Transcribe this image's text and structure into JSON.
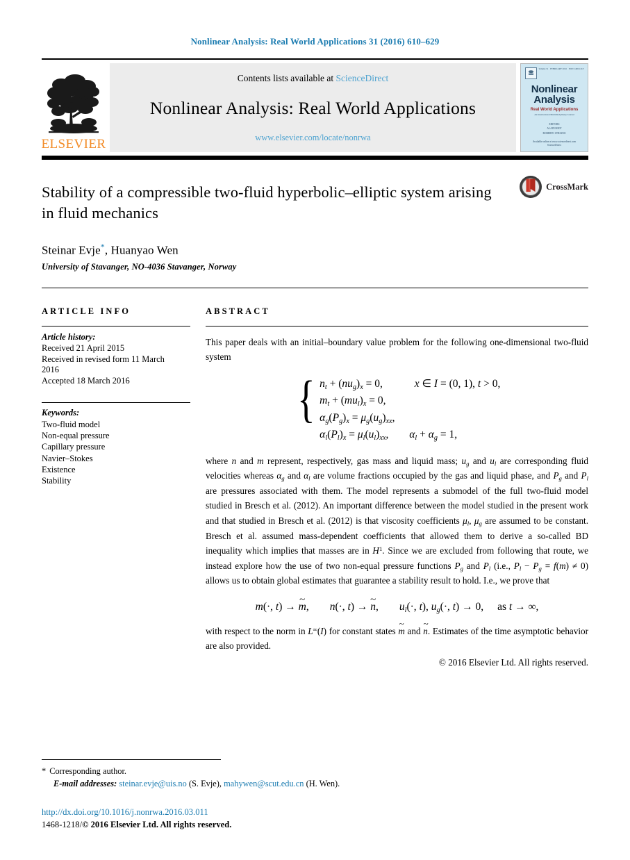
{
  "running_head": "Nonlinear Analysis: Real World Applications 31 (2016) 610–629",
  "masthead": {
    "contents_prefix": "Contents lists available at ",
    "sciencedirect": "ScienceDirect",
    "journal_title": "Nonlinear Analysis: Real World Applications",
    "journal_url": "www.elsevier.com/locate/nonrwa",
    "publisher": "ELSEVIER",
    "cover": {
      "title_line1": "Nonlinear",
      "title_line2": "Analysis",
      "subtitle": "Real World Applications",
      "subtitle2": "An International Multidisciplinary Journal",
      "editors_label": "EDITORS",
      "editor1": "ALAIN MIOT",
      "editor2": "ROBERTO STRIANO",
      "footer1": "Available online at www.sciencedirect.com",
      "footer2": "ScienceDirect",
      "vol_label": "Volume 31",
      "date_label": "FEBRUARY 2016",
      "issn_label": "ISSN 1468-1218"
    }
  },
  "article": {
    "title": "Stability of a compressible two-fluid hyperbolic–elliptic system arising in fluid mechanics",
    "authors": "Steinar Evje",
    "author_star": "*",
    "authors_rest": ", Huanyao Wen",
    "affiliation": "University of Stavanger, NO-4036 Stavanger, Norway",
    "crossmark_label": "CrossMark"
  },
  "info": {
    "heading": "ARTICLE INFO",
    "history_label": "Article history:",
    "history": [
      "Received 21 April 2015",
      "Received in revised form 11 March",
      "2016",
      "Accepted 18 March 2016"
    ],
    "keywords_label": "Keywords:",
    "keywords": [
      "Two-fluid model",
      "Non-equal pressure",
      "Capillary pressure",
      "Navier–Stokes",
      "Existence",
      "Stability"
    ]
  },
  "abstract": {
    "heading": "ABSTRACT",
    "para1": "This paper deals with an initial–boundary value problem for the following one-dimensional two-fluid system",
    "equation1": {
      "row1_lhs": "n_t + (nu_g)_x = 0,",
      "row1_cond": "x ∈ I = (0, 1), t > 0,",
      "row2": "m_t + (mu_l)_x = 0,",
      "row3": "α_g(P_g)_x = μ_g(u_g)_xx,",
      "row4_lhs": "α_l(P_l)_x = μ_l(u_l)_xx,",
      "row4_cond": "α_l + α_g = 1,"
    },
    "para2": "where n and m represent, respectively, gas mass and liquid mass; u_g and u_l are corresponding fluid velocities whereas α_g and α_l are volume fractions occupied by the gas and liquid phase, and P_g and P_l are pressures associated with them. The model represents a submodel of the full two-fluid model studied in Bresch et al. (2012). An important difference between the model studied in the present work and that studied in Bresch et al. (2012) is that viscosity coefficients μ_l, μ_g are assumed to be constant. Bresch et al. assumed mass-dependent coefficients that allowed them to derive a so-called BD inequality which implies that masses are in H^1. Since we are excluded from following that route, we instead explore how the use of two non-equal pressure functions P_g and P_l (i.e., P_l − P_g = f(m) ≠ 0) allows us to obtain global estimates that guarantee a stability result to hold. I.e., we prove that",
    "equation2": "m(·, t) → m̃,    n(·, t) → ñ,    u_l(·, t), u_g(·, t) → 0,   as t → ∞,",
    "para3": "with respect to the norm in L^∞(I) for constant states m̃ and ñ. Estimates of the time asymptotic behavior are also provided.",
    "copyright": "© 2016 Elsevier Ltd. All rights reserved."
  },
  "footnotes": {
    "star": "*",
    "corresponding": "Corresponding author.",
    "email_label": "E-mail addresses:",
    "email1": "steinar.evje@uis.no",
    "email1_owner": "(S. Evje),",
    "email2": "mahywen@scut.edu.cn",
    "email2_owner": "(H. Wen).",
    "doi": "http://dx.doi.org/10.1016/j.nonrwa.2016.03.011",
    "issn_prefix": "1468-1218/",
    "issn_rest": "© 2016 Elsevier Ltd. All rights reserved."
  },
  "colors": {
    "link": "#1a7bb0",
    "sciencedirect": "#4ea3d0",
    "elsevier_orange": "#f28c28",
    "cover_bg": "#cfe7f2"
  }
}
